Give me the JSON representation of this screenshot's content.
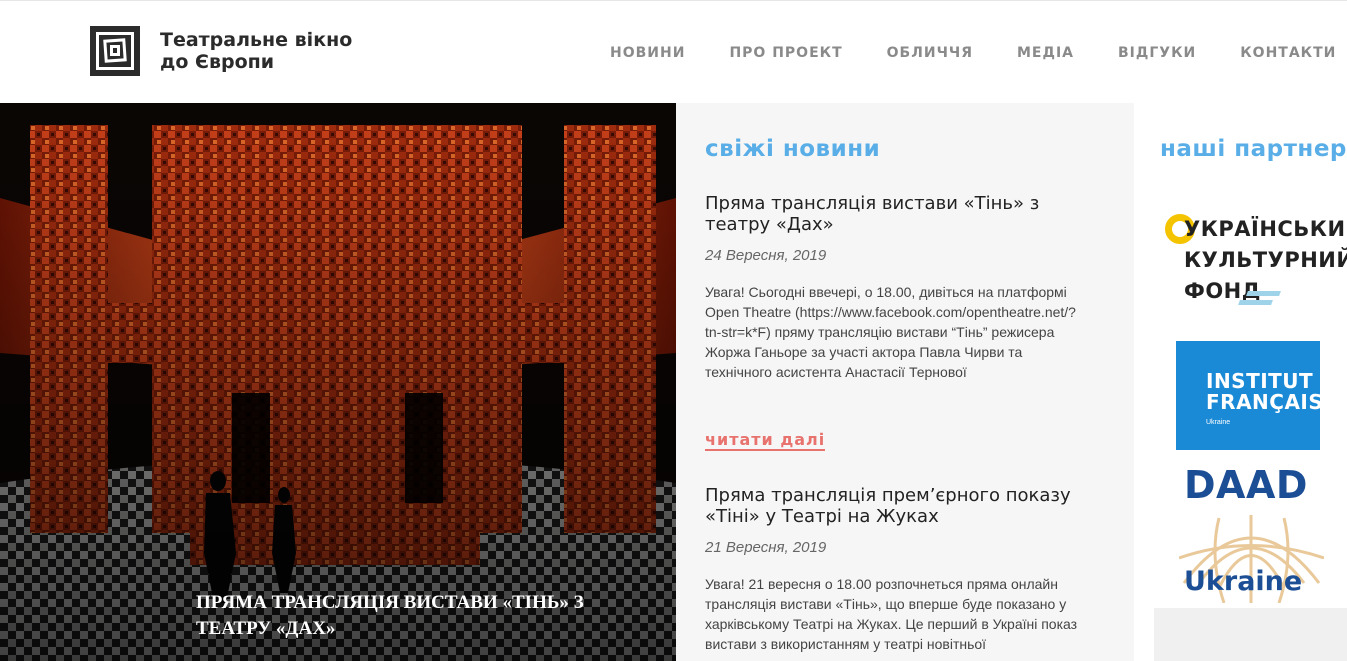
{
  "site": {
    "logo_line1": "Театральне вікно",
    "logo_line2": "до Європи"
  },
  "nav": {
    "items": [
      "НОВИНИ",
      "ПРО ПРОЕКТ",
      "ОБЛИЧЧЯ",
      "МЕДІА",
      "ВІДГУКИ",
      "КОНТАКТИ"
    ]
  },
  "hero": {
    "caption": "ПРЯМА ТРАНСЛЯЦІЯ ВИСТАВИ «ТІНЬ» З ТЕАТРУ «ДАХ»"
  },
  "news": {
    "title": "свіжі новини",
    "read_more": "читати далі",
    "articles": [
      {
        "title": "Пряма трансляція вистави «Тінь» з театру «Дах»",
        "date": "24 Вересня, 2019",
        "body": "Увага! Сьогодні ввечері, о 18.00, дивіться на платформі Open Theatre (https://www.facebook.com/opentheatre.net/?tn-str=k*F) пряму трансляцію вистави “Тінь” режисера Жоржа Ганьоре за участі актора Павла Чирви та технічного асистента Анастасії Тернової"
      },
      {
        "title": "Пряма трансляція прем’єрного показу «Тіні» у Театрі на Жуках",
        "date": "21 Вересня, 2019",
        "body": "Увага! 21 вересня о 18.00 розпочнеться пряма онлайн трансляція вистави «Тінь», що вперше буде показано у харківському Театрі на Жуках.  Це перший в Україні показ вистави з використанням у театрі новітньої"
      }
    ]
  },
  "partners": {
    "title": "наші партнери",
    "ucf": [
      "УКРАЇНСЬКИЙ",
      "КУЛЬТУРНИЙ",
      "ФОНД"
    ],
    "if_line1": "INSTITUT",
    "if_line2": "FRANÇAIS",
    "if_sub": "Ukraine",
    "daad": "DAAD",
    "daad_ukraine": "Ukraine"
  },
  "colors": {
    "accent_blue": "#5aaee7",
    "read_more": "#e8736e",
    "if_blue": "#1a8ad6",
    "daad_blue": "#1b4e94",
    "ucf_yellow": "#f5c400"
  }
}
